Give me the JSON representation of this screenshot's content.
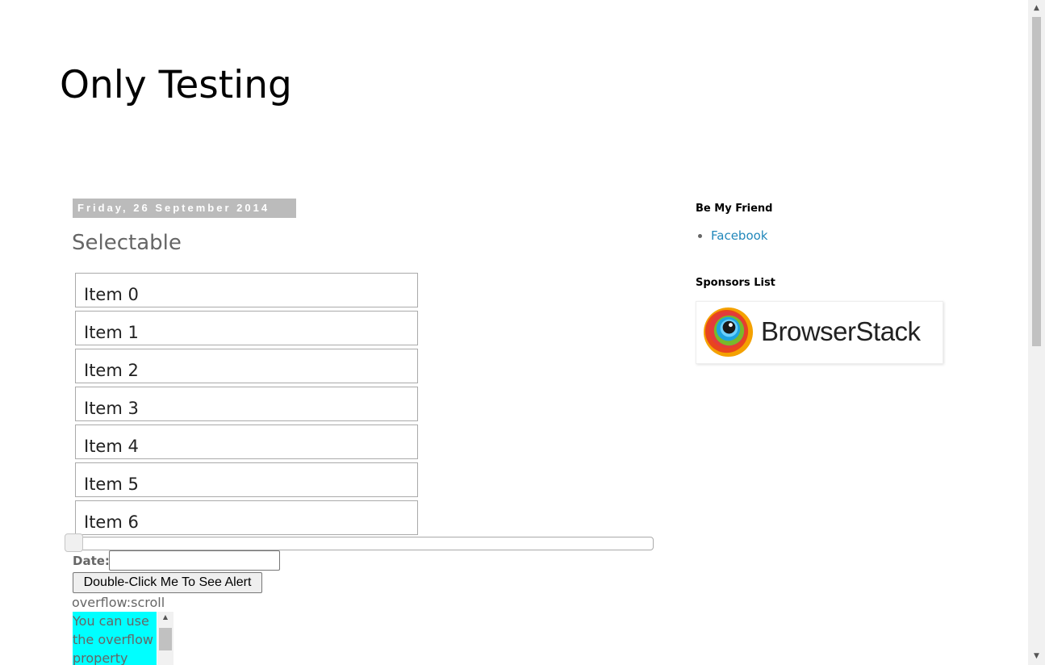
{
  "blog": {
    "title": "Only Testing"
  },
  "post": {
    "date": "Friday, 26 September 2014",
    "title": "Selectable",
    "items": [
      "Item 0",
      "Item 1",
      "Item 2",
      "Item 3",
      "Item 4",
      "Item 5",
      "Item 6"
    ],
    "slider_value": 0,
    "date_label": "Date:",
    "date_value": "",
    "button_label": "Double-Click Me To See Alert",
    "overflow_label": "overflow:scroll",
    "overflow_text": "You can use the overflow property"
  },
  "sidebar": {
    "friend_heading": "Be My Friend",
    "friend_links": [
      "Facebook"
    ],
    "sponsors_heading": "Sponsors List",
    "sponsor_logo": "BrowserStack"
  },
  "colors": {
    "link": "#2288bb",
    "date_header_bg": "#bbbbbb",
    "overflow_bg": "#00ffff"
  }
}
